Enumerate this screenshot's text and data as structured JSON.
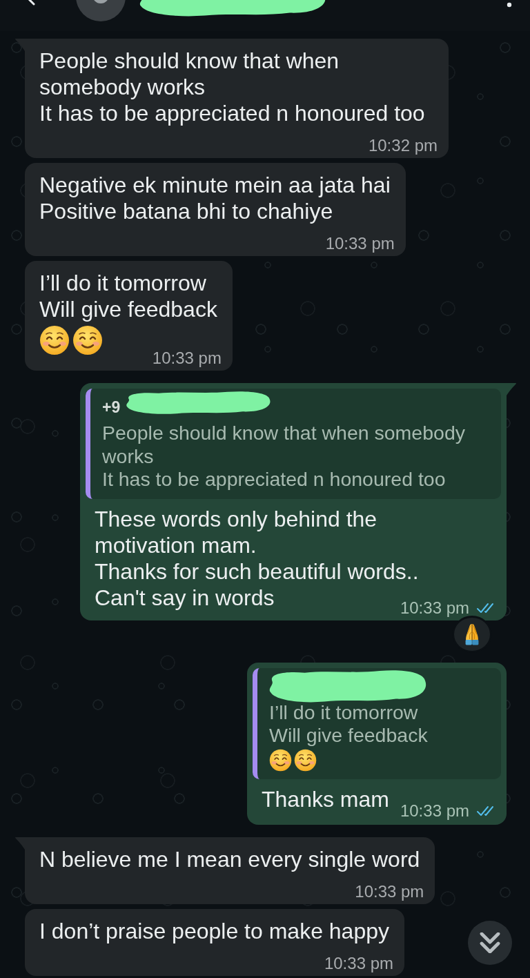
{
  "header": {
    "name_redacted": true
  },
  "messages": [
    {
      "outgoing": false,
      "tail": true,
      "text": "People should know that when somebody works\nIt has to be appreciated n honoured too",
      "time": "10:32 pm"
    },
    {
      "outgoing": false,
      "tail": false,
      "text": "Negative ek minute mein aa jata hai\nPositive batana bhi to chahiye",
      "time": "10:33 pm"
    },
    {
      "outgoing": false,
      "tail": false,
      "text": "I’ll do it tomorrow\nWill give feedback",
      "emojis": [
        {
          "kind": "smiling_face"
        },
        {
          "kind": "smiling_face"
        }
      ],
      "time": "10:33 pm"
    },
    {
      "outgoing": true,
      "tail": true,
      "quote": {
        "author": "+9",
        "author_redacted": true,
        "text": "People should know that when somebody works\nIt has to be appreciated n honoured too"
      },
      "text": "These words only behind the\nmotivation mam.\nThanks for such beautiful words..\nCan't say in words",
      "time": "10:33 pm",
      "read": true,
      "reaction": {
        "kind": "folded_hands"
      }
    },
    {
      "outgoing": true,
      "tail": false,
      "quote": {
        "author_redacted": true,
        "text": "I’ll do it tomorrow\nWill give feedback",
        "emojis": [
          {
            "kind": "smiling_face"
          },
          {
            "kind": "smiling_face"
          }
        ]
      },
      "text": "Thanks mam",
      "time": "10:33 pm",
      "read": true
    },
    {
      "outgoing": false,
      "tail": true,
      "text": "N believe me I mean every single word",
      "time": "10:33 pm"
    },
    {
      "outgoing": false,
      "tail": false,
      "text": "I don’t praise people to make happy",
      "time": "10:33 pm"
    }
  ]
}
